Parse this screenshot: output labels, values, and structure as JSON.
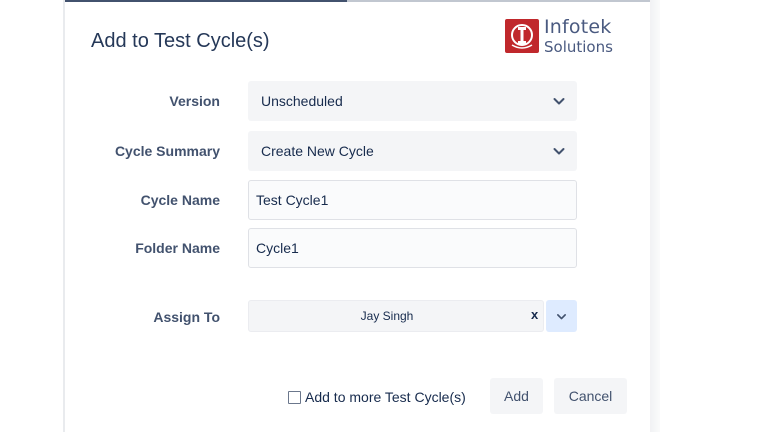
{
  "dialog": {
    "title": "Add to Test Cycle(s)"
  },
  "logo": {
    "line1": "Infotek",
    "line2": "Solutions",
    "brand_color": "#c0282c"
  },
  "fields": {
    "version": {
      "label": "Version",
      "value": "Unscheduled"
    },
    "cycle_summary": {
      "label": "Cycle Summary",
      "value": "Create New Cycle"
    },
    "cycle_name": {
      "label": "Cycle Name",
      "value": "Test Cycle1"
    },
    "folder_name": {
      "label": "Folder Name",
      "value": "Cycle1"
    },
    "assign_to": {
      "label": "Assign To",
      "value": "Jay Singh",
      "clear_label": "x"
    }
  },
  "footer": {
    "checkbox_label": "Add to more Test Cycle(s)",
    "add_label": "Add",
    "cancel_label": "Cancel"
  },
  "colors": {
    "select_bg": "#f4f5f7",
    "dropdown_active_bg": "#deebff",
    "text": "#172b4d"
  }
}
